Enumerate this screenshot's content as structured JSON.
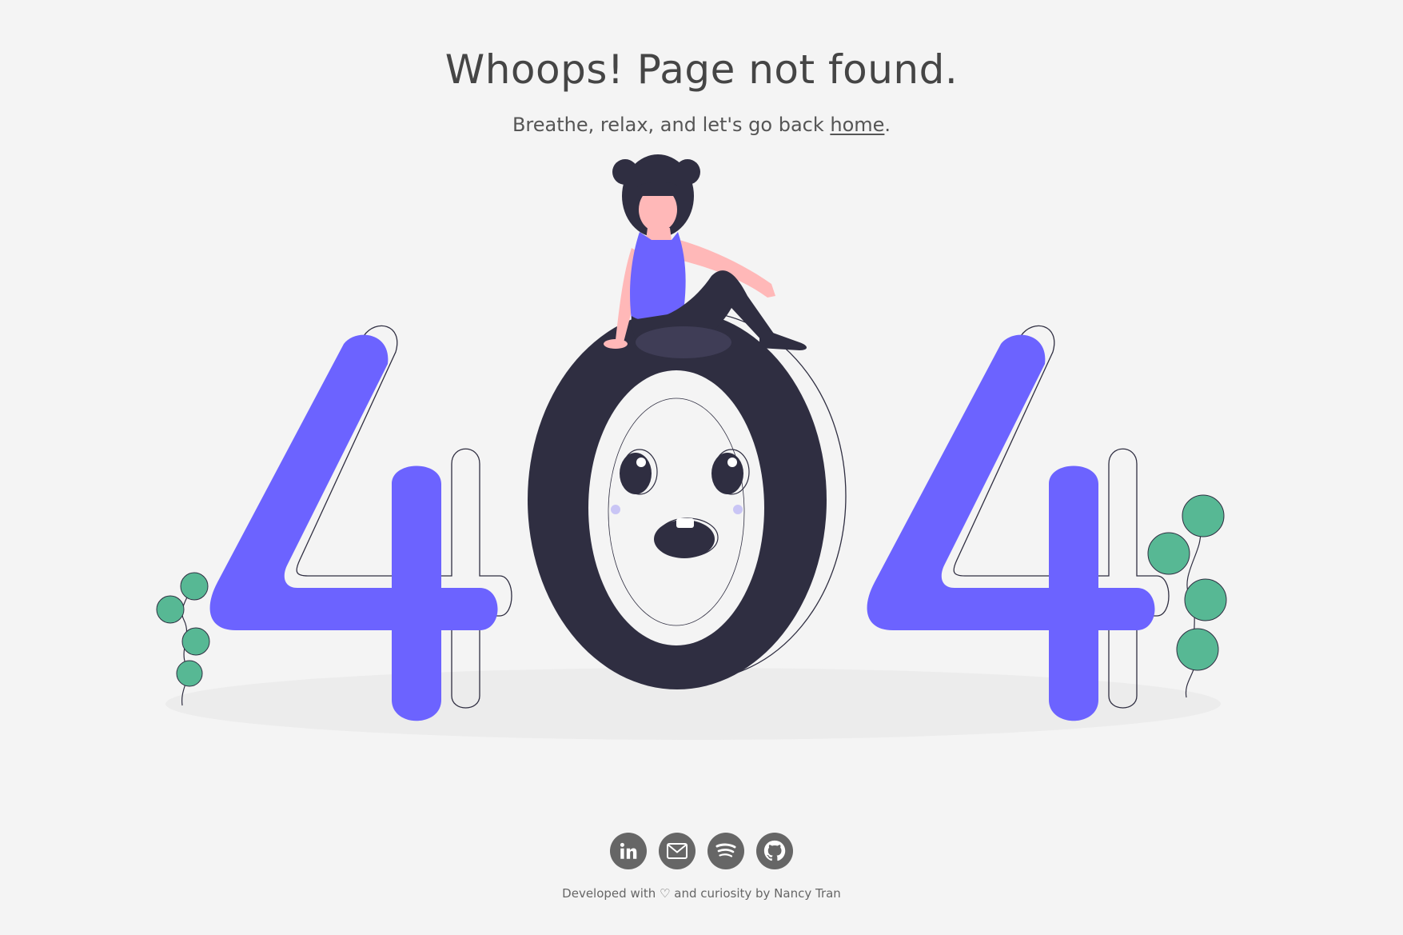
{
  "header": {
    "title": "Whoops! Page not found.",
    "subtitle_before": "Breathe, relax, and let's go back ",
    "home_link": "home",
    "subtitle_after": "."
  },
  "illustration": {
    "digits": "404",
    "accent_color": "#6c63ff",
    "dark_color": "#2f2e41",
    "leaf_color": "#57b894"
  },
  "socials": [
    {
      "name": "linkedin",
      "icon": "linkedin-icon"
    },
    {
      "name": "email",
      "icon": "email-icon"
    },
    {
      "name": "spotify",
      "icon": "spotify-icon"
    },
    {
      "name": "github",
      "icon": "github-icon"
    }
  ],
  "footer": {
    "credit": "Developed with ♡ and curiosity by Nancy Tran"
  }
}
